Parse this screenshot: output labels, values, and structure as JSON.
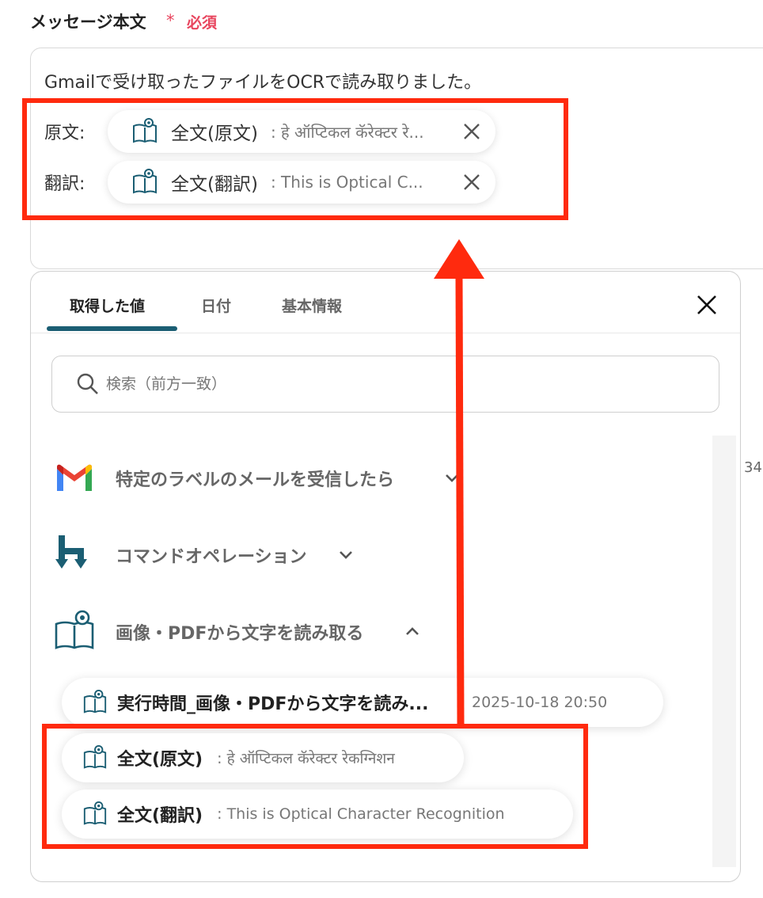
{
  "field": {
    "label": "メッセージ本文",
    "required_mark": "*",
    "required_text": "必須"
  },
  "editor": {
    "first_line": "Gmailで受け取ったファイルをOCRで読み取りました。",
    "rows": [
      {
        "label": "原文:",
        "token_name": "全文(原文)",
        "token_preview": ": हे ऑप्टिकल कॅरेक्टर रे..."
      },
      {
        "label": "翻訳:",
        "token_name": "全文(翻訳)",
        "token_preview": ": This is Optical C..."
      }
    ]
  },
  "panel": {
    "tabs": [
      {
        "label": "取得した値"
      },
      {
        "label": "日付"
      },
      {
        "label": "基本情報"
      }
    ],
    "search_placeholder": "検索（前方一致）",
    "side_number": "34",
    "sections": [
      {
        "title": "特定のラベルのメールを受信したら",
        "icon": "gmail-icon",
        "expanded": false
      },
      {
        "title": "コマンドオペレーション",
        "icon": "command-icon",
        "expanded": false
      },
      {
        "title": "画像・PDFから文字を読み取る",
        "icon": "ocr-book-icon",
        "expanded": true
      }
    ],
    "values": [
      {
        "name": "実行時間_画像・PDFから文字を読み...",
        "preview": "2025-10-18 20:50"
      },
      {
        "name": "全文(原文)",
        "preview": ": हे ऑप्टिकल कॅरेक्टर रेकग्निशन"
      },
      {
        "name": "全文(翻訳)",
        "preview": ": This is Optical Character Recognition"
      }
    ]
  },
  "colors": {
    "highlight": "#ff2a0e",
    "tab_underline": "#1b5e73",
    "required": "#e8455e",
    "icon_teal": "#1b5e73"
  }
}
